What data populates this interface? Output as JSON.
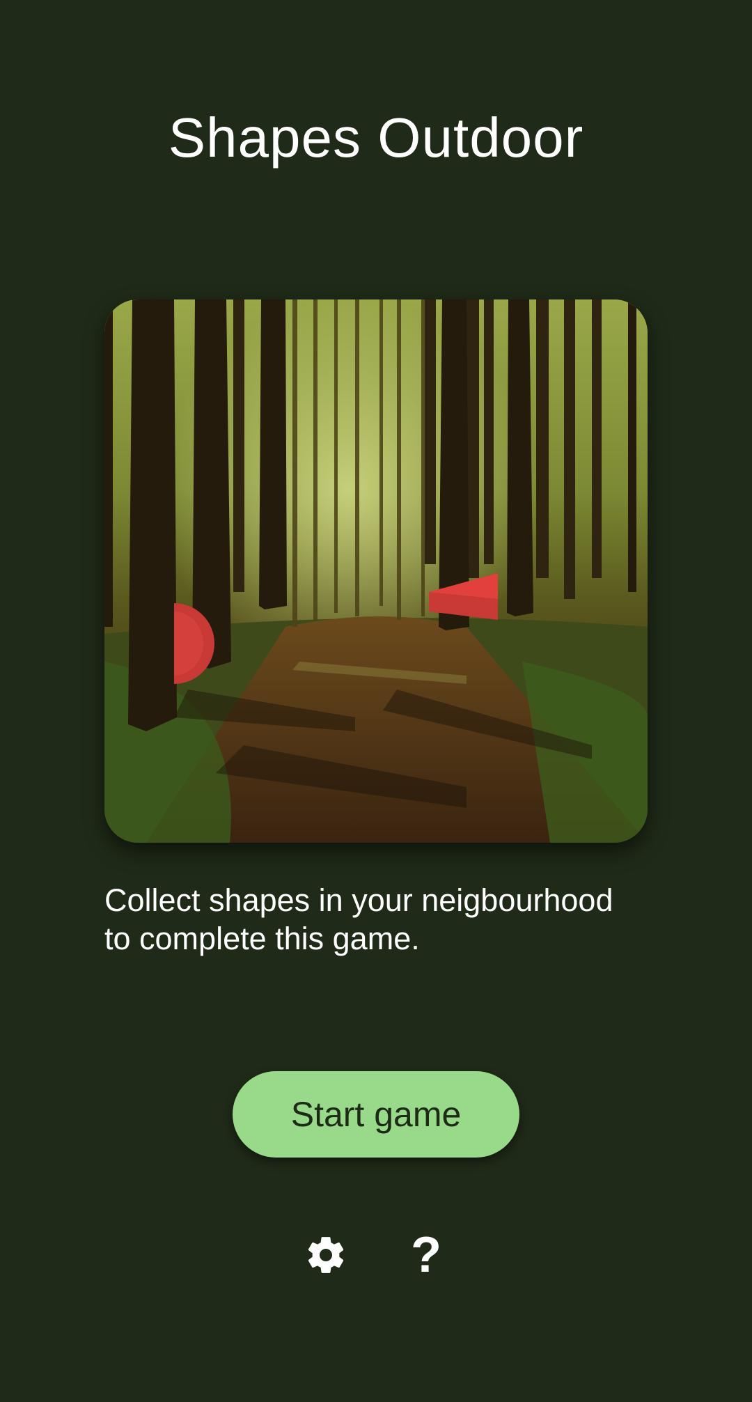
{
  "app": {
    "title": "Shapes Outdoor"
  },
  "hero": {
    "image_description_icon": "forest-path-image",
    "shapes": [
      "circle-shape",
      "triangle-shape"
    ],
    "shape_color": "#e2403c"
  },
  "description": {
    "line1": "Collect shapes in your neigbourhood",
    "line2": "to complete this game."
  },
  "actions": {
    "start_label": "Start game",
    "settings_icon": "gear-icon",
    "help_icon": "help-icon",
    "help_glyph": "?"
  },
  "colors": {
    "background": "#1f2a18",
    "accent": "#98d98a",
    "accent_text": "#1d2a16"
  }
}
